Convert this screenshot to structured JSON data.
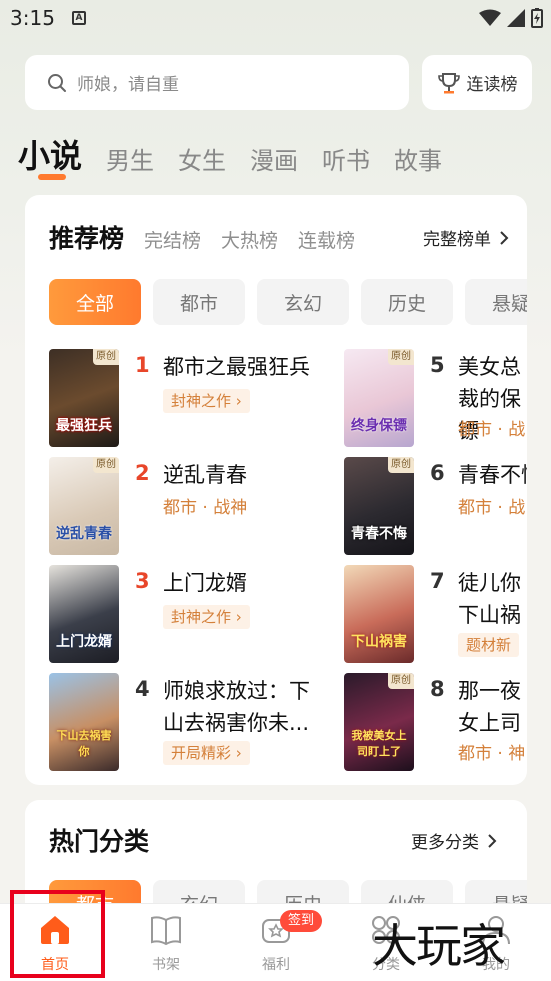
{
  "status": {
    "time": "3:15"
  },
  "search": {
    "placeholder": "师娘，请自重"
  },
  "rank_button": {
    "label": "连读榜"
  },
  "categories": [
    "小说",
    "男生",
    "女生",
    "漫画",
    "听书",
    "故事"
  ],
  "recommend": {
    "title": "推荐榜",
    "sub_tabs": [
      "完结榜",
      "大热榜",
      "连载榜"
    ],
    "more": "完整榜单",
    "chips": [
      "全部",
      "都市",
      "玄幻",
      "历史",
      "悬疑"
    ],
    "badge": "原创",
    "books": [
      {
        "rank": "1",
        "name": "都市之最强狂兵",
        "tag": "封神之作",
        "tag_style": "box",
        "cover_text": "最强狂兵"
      },
      {
        "rank": "2",
        "name": "逆乱青春",
        "tag": "都市 · 战神",
        "tag_style": "plain",
        "cover_text": "逆乱青春"
      },
      {
        "rank": "3",
        "name": "上门龙婿",
        "tag": "封神之作",
        "tag_style": "box",
        "cover_text": "上门龙婿"
      },
      {
        "rank": "4",
        "name": "师娘求放过：下山去祸害你未...",
        "tag": "开局精彩",
        "tag_style": "box",
        "cover_text": "下山去祸害你"
      },
      {
        "rank": "5",
        "name": "美女总裁的保镖",
        "tag": "都市 · 战",
        "tag_style": "plain",
        "cover_text": "终身保镖"
      },
      {
        "rank": "6",
        "name": "青春不悔",
        "tag": "都市 · 战",
        "tag_style": "plain",
        "cover_text": "青春不悔"
      },
      {
        "rank": "7",
        "name": "徒儿你下山祸",
        "tag": "题材新",
        "tag_style": "box",
        "cover_text": "下山祸害"
      },
      {
        "rank": "8",
        "name": "那一夜女上司",
        "tag": "都市 · 神",
        "tag_style": "plain",
        "cover_text": "我被美女上司盯上了"
      }
    ]
  },
  "hot": {
    "title": "热门分类",
    "more": "更多分类",
    "chips": [
      "都市",
      "玄幻",
      "历史",
      "仙侠",
      "悬疑"
    ]
  },
  "nav": {
    "items": [
      "首页",
      "书架",
      "福利",
      "分类",
      "我的"
    ],
    "badge": "签到"
  },
  "watermark": "大玩家",
  "colors": {
    "accent": "#ff7a2e",
    "rank_top": "#e8462a",
    "highlight": "#e8001c"
  }
}
